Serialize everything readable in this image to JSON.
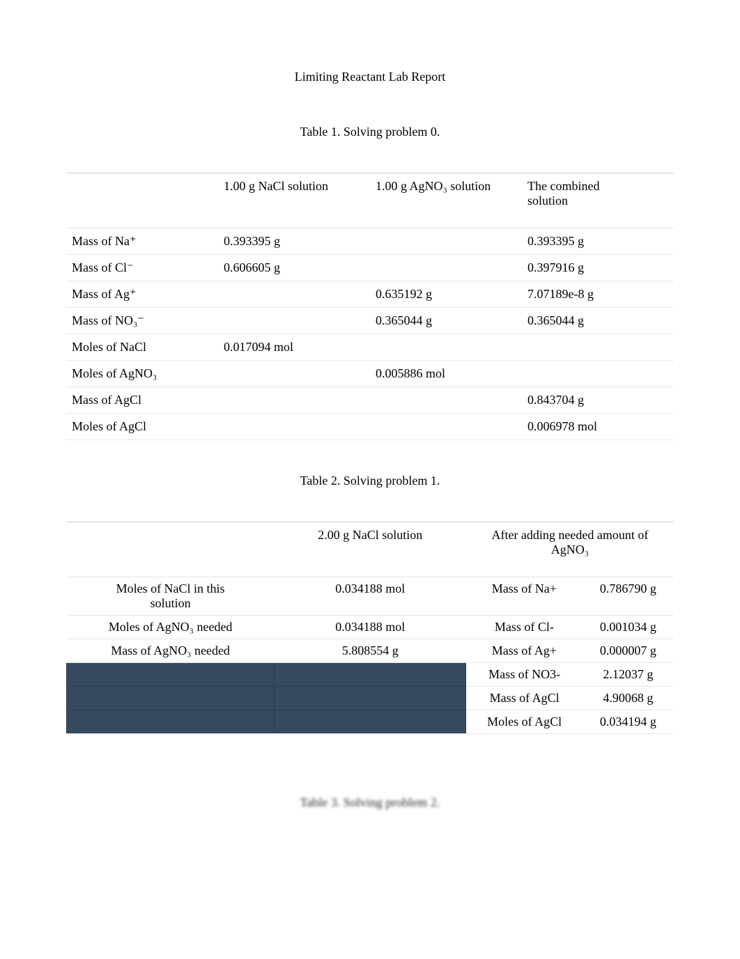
{
  "title": "Limiting Reactant Lab Report",
  "caption_t1": "Table 1. Solving problem 0.",
  "caption_t2": "Table 2. Solving problem 1.",
  "caption_t3": "Table 3. Solving problem 2.",
  "t1": {
    "h_col1": "1.00 g NaCl solution",
    "h_col2": "1.00 g AgNO₃ solution",
    "h_col3_line1": "The combined",
    "h_col3_line2": "solution",
    "rows": [
      {
        "label": "Mass of Na⁺",
        "c1": "0.393395 g",
        "c2": "",
        "c3": "0.393395 g"
      },
      {
        "label": "Mass of Cl⁻",
        "c1": "0.606605 g",
        "c2": "",
        "c3": "0.397916 g"
      },
      {
        "label": "Mass of Ag⁺",
        "c1": "",
        "c2": "0.635192 g",
        "c3": "7.07189e-8 g"
      },
      {
        "label": "Mass of NO₃⁻",
        "c1": "",
        "c2": "0.365044 g",
        "c3": "0.365044 g"
      },
      {
        "label": "Moles of NaCl",
        "c1": "0.017094 mol",
        "c2": "",
        "c3": ""
      },
      {
        "label": "Moles of AgNO₃",
        "c1": "",
        "c2": "0.005886 mol",
        "c3": ""
      },
      {
        "label": "Mass of AgCl",
        "c1": "",
        "c2": "",
        "c3": "0.843704 g"
      },
      {
        "label": "Moles of AgCl",
        "c1": "",
        "c2": "",
        "c3": "0.006978 mol"
      }
    ]
  },
  "t2": {
    "h_col1": "2.00 g NaCl solution",
    "h_col2_3": "After adding needed amount of AgNO₃",
    "left_rows": [
      {
        "label_l1": "Moles of NaCl in this",
        "label_l2": "solution",
        "val": "0.034188 mol"
      },
      {
        "label_l1": "Moles of AgNO₃ needed",
        "label_l2": "",
        "val": "0.034188 mol"
      },
      {
        "label_l1": "Mass of AgNO₃ needed",
        "label_l2": "",
        "val": "5.808554 g"
      }
    ],
    "right_rows": [
      {
        "label": "Mass of Na+",
        "val": "0.786790 g"
      },
      {
        "label": "Mass of Cl-",
        "val": "0.001034 g"
      },
      {
        "label": "Mass of Ag+",
        "val": "0.000007 g"
      },
      {
        "label": "Mass of NO3-",
        "val": "2.12037 g"
      },
      {
        "label": "Mass of AgCl",
        "val": "4.90068 g"
      },
      {
        "label": "Moles of AgCl",
        "val": "0.034194 g"
      }
    ]
  }
}
